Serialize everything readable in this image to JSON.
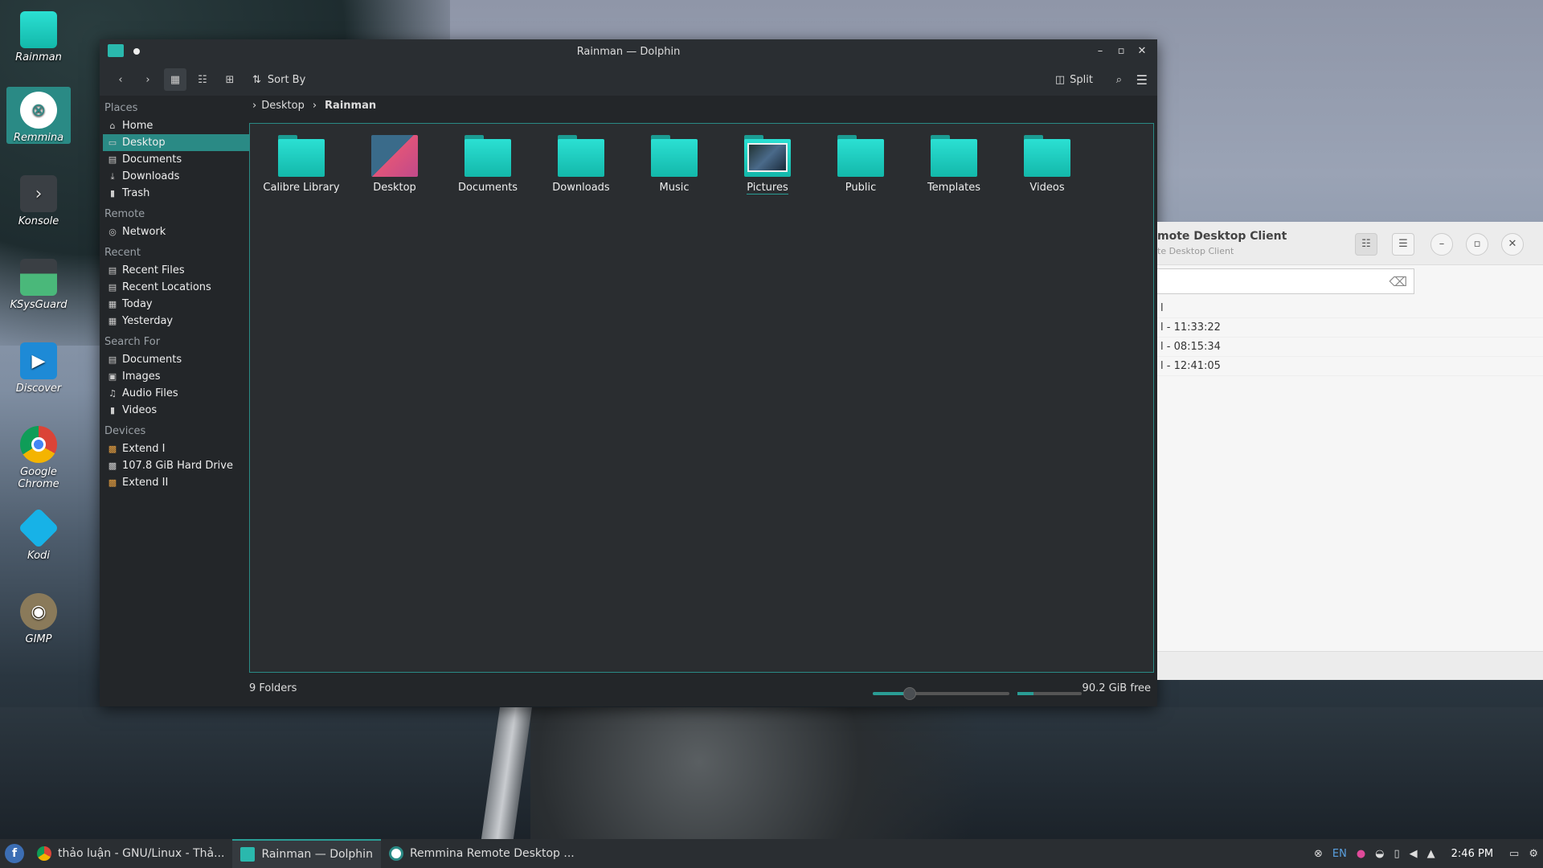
{
  "desktop": {
    "icons": [
      {
        "label": "Rainman",
        "icon": "folder-icon"
      },
      {
        "label": "Remmina",
        "icon": "remmina-icon"
      },
      {
        "label": "Konsole",
        "icon": "terminal-icon"
      },
      {
        "label": "KSysGuard",
        "icon": "system-monitor-icon"
      },
      {
        "label": "Discover",
        "icon": "store-icon"
      },
      {
        "label": "Google Chrome",
        "icon": "chrome-icon"
      },
      {
        "label": "Kodi",
        "icon": "kodi-icon"
      },
      {
        "label": "GIMP",
        "icon": "gimp-icon"
      }
    ]
  },
  "dolphin": {
    "title": "Rainman — Dolphin",
    "toolbar": {
      "sort_label": "Sort By",
      "split_label": "Split"
    },
    "sidebar": {
      "places_header": "Places",
      "places": [
        "Home",
        "Desktop",
        "Documents",
        "Downloads",
        "Trash"
      ],
      "remote_header": "Remote",
      "remote": [
        "Network"
      ],
      "recent_header": "Recent",
      "recent": [
        "Recent Files",
        "Recent Locations",
        "Today",
        "Yesterday"
      ],
      "search_header": "Search For",
      "search": [
        "Documents",
        "Images",
        "Audio Files",
        "Videos"
      ],
      "devices_header": "Devices",
      "devices": [
        "Extend I",
        "107.8 GiB Hard Drive",
        "Extend II"
      ]
    },
    "breadcrumb": {
      "parent": "Desktop",
      "current": "Rainman"
    },
    "folders": [
      "Calibre Library",
      "Desktop",
      "Documents",
      "Downloads",
      "Music",
      "Pictures",
      "Public",
      "Templates",
      "Videos"
    ],
    "status": {
      "count": "9 Folders",
      "free": "90.2 GiB free",
      "zoom_fraction": 0.27,
      "disk_used_fraction": 0.25
    }
  },
  "remmina": {
    "title": "mote Desktop Client",
    "subtitle": "te Desktop Client",
    "header_col": "l",
    "rows": [
      "l - 11:33:22",
      "l - 08:15:34",
      "l - 12:41:05"
    ]
  },
  "taskbar": {
    "tasks": [
      "thảo luận - GNU/Linux - Thả...",
      "Rainman — Dolphin",
      "Remmina Remote Desktop ..."
    ],
    "lang": "EN",
    "clock": "2:46 PM"
  }
}
